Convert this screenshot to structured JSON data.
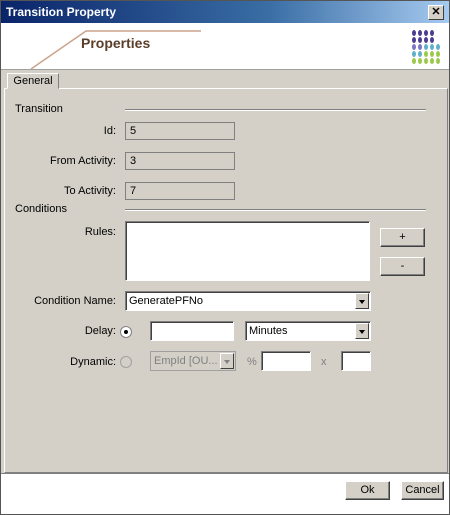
{
  "window": {
    "title": "Transition Property"
  },
  "banner": {
    "title": "Properties"
  },
  "tabs": [
    {
      "label": "General"
    }
  ],
  "transition": {
    "section_label": "Transition",
    "id_label": "Id:",
    "id_value": "5",
    "from_label": "From Activity:",
    "from_value": "3",
    "to_label": "To Activity:",
    "to_value": "7"
  },
  "conditions": {
    "section_label": "Conditions",
    "rules_label": "Rules:",
    "rules_value": "",
    "add_button": "+",
    "remove_button": "-",
    "condition_name_label": "Condition Name:",
    "condition_name_value": "GeneratePFNo",
    "delay_label": "Delay:",
    "delay_value": "",
    "delay_unit": "Minutes",
    "dynamic_label": "Dynamic:",
    "dynamic_field": "EmpId [OU...",
    "percent_symbol": "%",
    "percent_value": "",
    "multiply_symbol": "x",
    "multiplier_value": ""
  },
  "footer": {
    "ok": "Ok",
    "cancel": "Cancel"
  },
  "colors": {
    "title_start": "#0a246a",
    "title_end": "#a6caf0",
    "banner_text": "#5a3e2a"
  }
}
